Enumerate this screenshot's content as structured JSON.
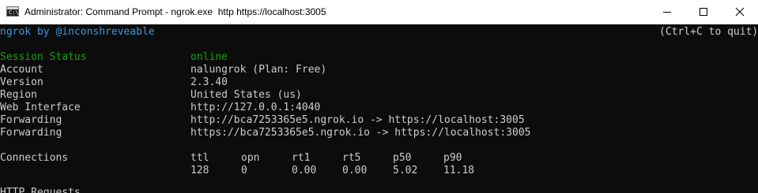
{
  "window": {
    "title": "Administrator: Command Prompt - ngrok.exe  http https://localhost:3005",
    "icon": "cmd-icon",
    "prompt_glyph": "C:\\"
  },
  "header": {
    "brand": "ngrok by @inconshreveable",
    "quit_hint": "(Ctrl+C to quit)"
  },
  "status": {
    "session_status_label": "Session Status",
    "session_status_value": "online",
    "account_label": "Account",
    "account_value": "nalungrok (Plan: Free)",
    "version_label": "Version",
    "version_value": "2.3.40",
    "region_label": "Region",
    "region_value": "United States (us)",
    "web_interface_label": "Web Interface",
    "web_interface_value": "http://127.0.0.1:4040",
    "forwarding_label": "Forwarding",
    "forwarding_http": "http://bca7253365e5.ngrok.io -> https://localhost:3005",
    "forwarding_https": "https://bca7253365e5.ngrok.io -> https://localhost:3005"
  },
  "connections": {
    "label": "Connections",
    "headers": [
      "ttl",
      "opn",
      "rt1",
      "rt5",
      "p50",
      "p90"
    ],
    "values": [
      "128",
      "0",
      "0.00",
      "0.00",
      "5.02",
      "11.18"
    ]
  },
  "footer": {
    "partial_text": "HTTP Requests"
  },
  "colors": {
    "console_bg": "#0c0c0c",
    "console_text": "#cccccc",
    "cyan": "#3a96dd",
    "green": "#13a10e"
  }
}
